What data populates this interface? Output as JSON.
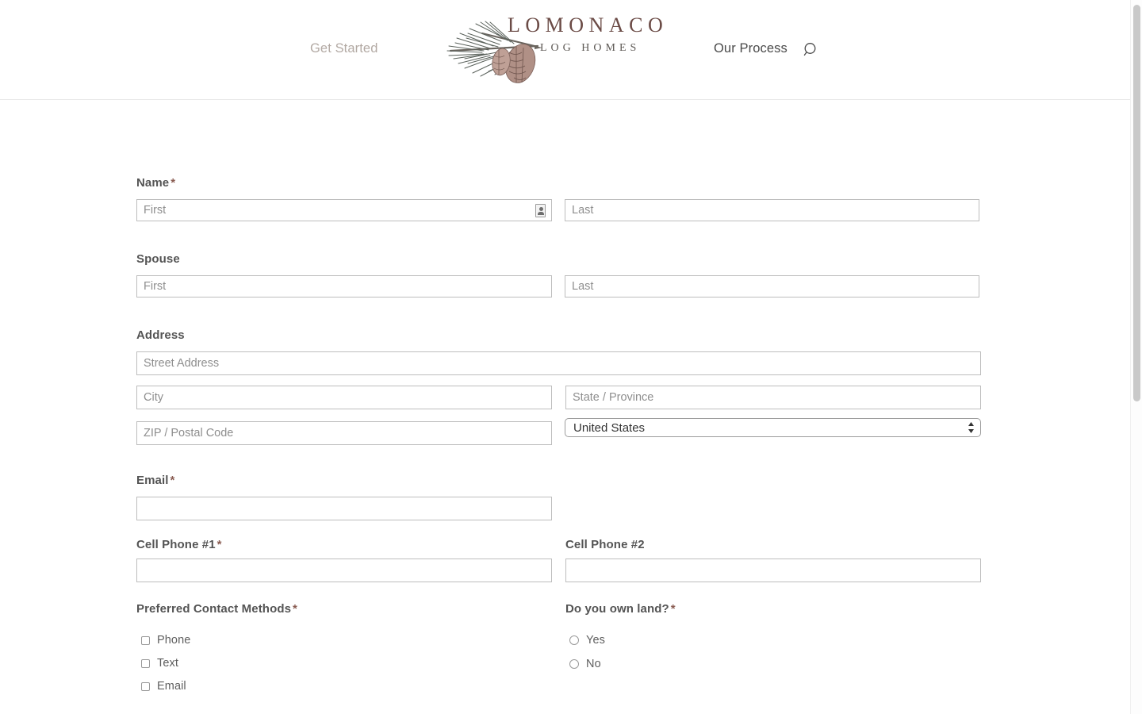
{
  "header": {
    "nav_left": "Get Started",
    "nav_right": "Our Process",
    "search_icon": "search-icon",
    "logo": {
      "name_line": "LOMONACO",
      "tagline": "LOG HOMES",
      "icon": "pine-branch-pinecone-icon",
      "text_color": "#6b4b46",
      "branch_color": "#5b625c"
    }
  },
  "form": {
    "name": {
      "label": "Name",
      "required_marker": "*",
      "first_placeholder": "First",
      "last_placeholder": "Last",
      "first_value": "",
      "last_value": "",
      "autofill_icon": "contact-card-icon"
    },
    "spouse": {
      "label": "Spouse",
      "first_placeholder": "First",
      "last_placeholder": "Last",
      "first_value": "",
      "last_value": ""
    },
    "address": {
      "label": "Address",
      "street_placeholder": "Street Address",
      "city_placeholder": "City",
      "state_placeholder": "State / Province",
      "zip_placeholder": "ZIP / Postal Code",
      "street_value": "",
      "city_value": "",
      "state_value": "",
      "zip_value": "",
      "country_selected": "United States",
      "country_options": [
        "United States"
      ]
    },
    "email": {
      "label": "Email",
      "required_marker": "*",
      "value": "",
      "placeholder": ""
    },
    "cell_phone_1": {
      "label": "Cell Phone #1",
      "required_marker": "*",
      "value": "",
      "placeholder": ""
    },
    "cell_phone_2": {
      "label": "Cell Phone #2",
      "value": "",
      "placeholder": ""
    },
    "preferred_contact": {
      "label": "Preferred Contact Methods",
      "required_marker": "*",
      "options": [
        {
          "label": "Phone",
          "checked": false
        },
        {
          "label": "Text",
          "checked": false
        },
        {
          "label": "Email",
          "checked": false
        }
      ]
    },
    "own_land": {
      "label": "Do you own land?",
      "required_marker": "*",
      "options": [
        {
          "label": "Yes",
          "selected": false
        },
        {
          "label": "No",
          "selected": false
        }
      ]
    }
  },
  "colors": {
    "required_asterisk": "#8a5c52",
    "label_text": "#545454",
    "placeholder_text": "#8e8e8e",
    "nav_inactive": "#b3aaa4",
    "nav_active": "#4a4a4a",
    "field_border": "#bdbdbd"
  },
  "scrollbar": {
    "name": "page-scrollbar"
  }
}
